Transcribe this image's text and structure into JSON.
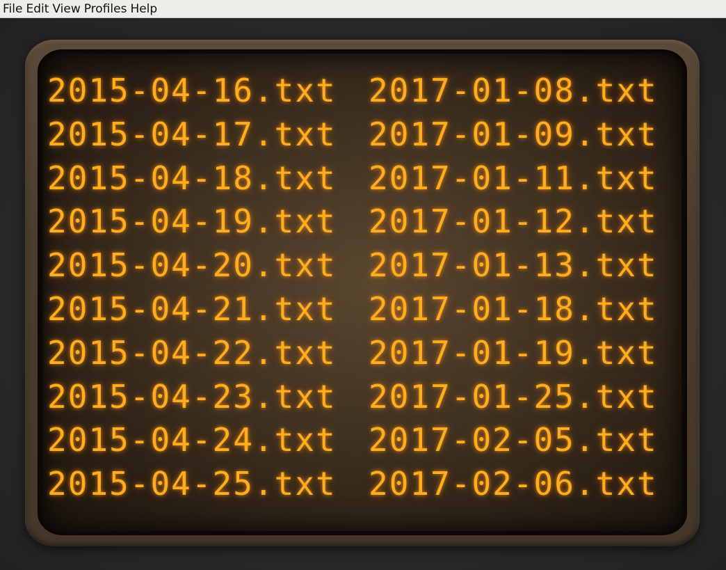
{
  "menubar": {
    "items": [
      "File",
      "Edit",
      "View",
      "Profiles",
      "Help"
    ]
  },
  "terminal": {
    "text_color": "#ffad1f",
    "background_color": "#3e3120",
    "columns": [
      [
        "2015-04-16.txt",
        "2015-04-17.txt",
        "2015-04-18.txt",
        "2015-04-19.txt",
        "2015-04-20.txt",
        "2015-04-21.txt",
        "2015-04-22.txt",
        "2015-04-23.txt",
        "2015-04-24.txt",
        "2015-04-25.txt"
      ],
      [
        "2017-01-08.txt",
        "2017-01-09.txt",
        "2017-01-11.txt",
        "2017-01-12.txt",
        "2017-01-13.txt",
        "2017-01-18.txt",
        "2017-01-19.txt",
        "2017-01-25.txt",
        "2017-02-05.txt",
        "2017-02-06.txt"
      ]
    ]
  }
}
